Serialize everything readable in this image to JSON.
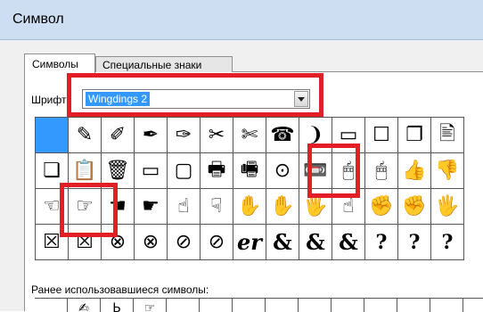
{
  "window": {
    "title": "Символ"
  },
  "tabs": [
    {
      "label": "Символы"
    },
    {
      "label": "Специальные знаки"
    }
  ],
  "font": {
    "label": "Шрифт:",
    "value": "Wingdings 2"
  },
  "grid": {
    "rows": [
      [
        "",
        "✎",
        "✐",
        "✒",
        "✑",
        "✂",
        "✄",
        "☎",
        "❩",
        "▭",
        "☐",
        "❐",
        "🖹"
      ],
      [
        "❏",
        "📋",
        "🗑",
        "▭",
        "▢",
        "🖶",
        "🖷",
        "⊙",
        "📼",
        "🖱",
        "🖱",
        "👍",
        "👎"
      ],
      [
        "☜",
        "☞",
        "☚",
        "☛",
        "☝",
        "☟",
        "✋",
        "✋",
        "🖐",
        "☝",
        "✊",
        "✊",
        "🖐"
      ],
      [
        "☒",
        "☒",
        "⊗",
        "⊗",
        "⊘",
        "⊘",
        "er",
        "&",
        "&",
        "&",
        "?",
        "?",
        "?"
      ]
    ]
  },
  "recent": {
    "label": "Ранее использовавшиеся символы:",
    "symbols": [
      "",
      "✍",
      "Ь",
      "☞",
      "",
      "",
      "",
      "",
      "",
      "",
      "",
      "",
      ""
    ]
  },
  "highlight_color": "#e21f26",
  "selection_color": "#3399ff"
}
